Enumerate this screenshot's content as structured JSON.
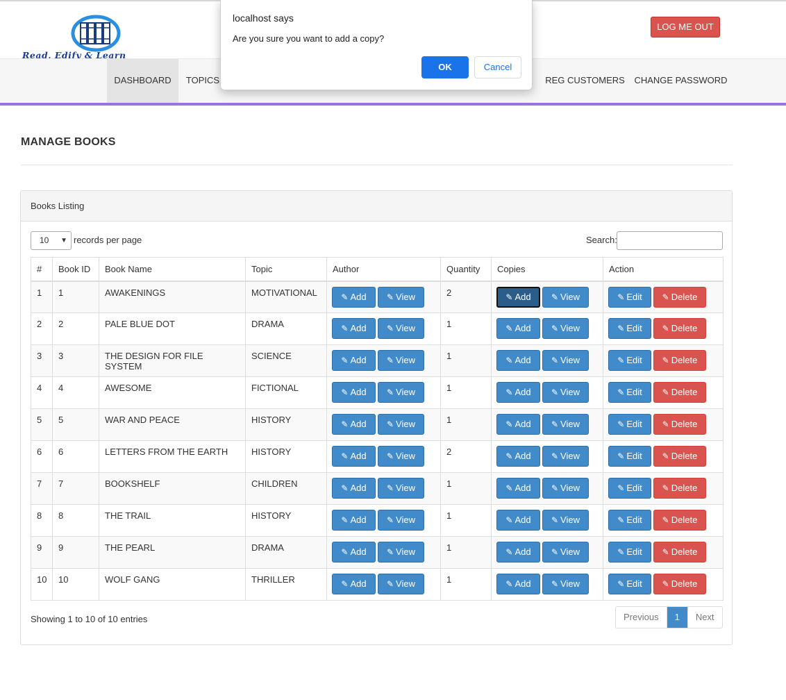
{
  "header": {
    "logo_text": "Read, Edify & Learn",
    "logout_label": "LOG ME OUT"
  },
  "nav": {
    "items": [
      {
        "label": "DASHBOARD",
        "active": true
      },
      {
        "label": "TOPICS",
        "active": false
      },
      {
        "label": "REG CUSTOMERS",
        "active": false
      },
      {
        "label": "CHANGE PASSWORD",
        "active": false
      }
    ]
  },
  "page": {
    "title": "MANAGE BOOKS"
  },
  "panel": {
    "heading": "Books Listing",
    "length_value": "10",
    "length_label": "records per page",
    "search_label": "Search:",
    "search_value": ""
  },
  "table": {
    "columns": [
      "#",
      "Book ID",
      "Book Name",
      "Topic",
      "Author",
      "Quantity",
      "Copies",
      "Action"
    ],
    "buttons": {
      "add": "Add",
      "view": "View",
      "edit": "Edit",
      "delete": "Delete"
    },
    "rows": [
      {
        "num": "1",
        "id": "1",
        "name": "AWAKENINGS",
        "topic": "MOTIVATIONAL",
        "qty": "2"
      },
      {
        "num": "2",
        "id": "2",
        "name": "PALE BLUE DOT",
        "topic": "DRAMA",
        "qty": "1"
      },
      {
        "num": "3",
        "id": "3",
        "name": "THE DESIGN FOR FILE SYSTEM",
        "topic": "SCIENCE",
        "qty": "1"
      },
      {
        "num": "4",
        "id": "4",
        "name": "AWESOME",
        "topic": "FICTIONAL",
        "qty": "1"
      },
      {
        "num": "5",
        "id": "5",
        "name": "WAR AND PEACE",
        "topic": "HISTORY",
        "qty": "1"
      },
      {
        "num": "6",
        "id": "6",
        "name": "LETTERS FROM THE EARTH",
        "topic": "HISTORY",
        "qty": "2"
      },
      {
        "num": "7",
        "id": "7",
        "name": "BOOKSHELF",
        "topic": "CHILDREN",
        "qty": "1"
      },
      {
        "num": "8",
        "id": "8",
        "name": "THE TRAIL",
        "topic": "HISTORY",
        "qty": "1"
      },
      {
        "num": "9",
        "id": "9",
        "name": "THE PEARL",
        "topic": "DRAMA",
        "qty": "1"
      },
      {
        "num": "10",
        "id": "10",
        "name": "WOLF GANG",
        "topic": "THRILLER",
        "qty": "1"
      }
    ]
  },
  "footer": {
    "info": "Showing 1 to 10 of 10 entries",
    "prev_label": "Previous",
    "current_page": "1",
    "next_label": "Next"
  },
  "dialog": {
    "title": "localhost says",
    "message": "Are you sure you want to add a copy?",
    "ok_label": "OK",
    "cancel_label": "Cancel"
  },
  "colors": {
    "primary": "#428bca",
    "danger": "#d9534f",
    "nav_underline": "#9575e0",
    "dialog_ok": "#1a73e8"
  },
  "icons": {
    "edit": "edit-square-icon",
    "pencil": "pencil-icon",
    "logo": "books-logo-icon"
  }
}
